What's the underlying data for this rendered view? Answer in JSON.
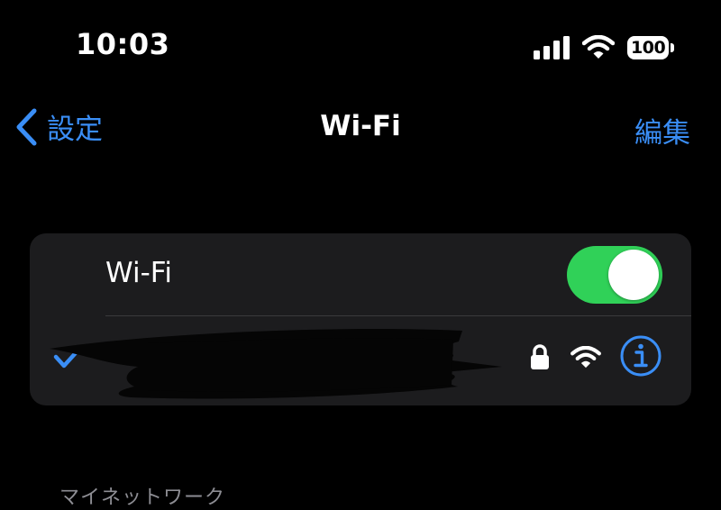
{
  "status_bar": {
    "time": "10:03",
    "battery_level": "100",
    "signal_icon": "cellular-signal-icon",
    "wifi_icon": "wifi-icon",
    "battery_icon": "battery-icon"
  },
  "nav": {
    "back_label": "設定",
    "back_icon": "chevron-left-icon",
    "title": "Wi-Fi",
    "edit_label": "編集"
  },
  "wifi_section": {
    "toggle_label": "Wi-Fi",
    "toggle_on": true,
    "connected_network": {
      "name": "",
      "name_redacted": true,
      "check_icon": "checkmark-icon",
      "lock_icon": "lock-icon",
      "signal_icon": "wifi-icon",
      "info_icon": "info-icon"
    }
  },
  "my_networks_header": "マイネットワーク",
  "colors": {
    "background": "#000000",
    "card": "#1c1c1e",
    "accent": "#3a8ef6",
    "toggle_on": "#30d158",
    "separator": "#3a3a3c",
    "secondary_text": "#8d8d93"
  }
}
